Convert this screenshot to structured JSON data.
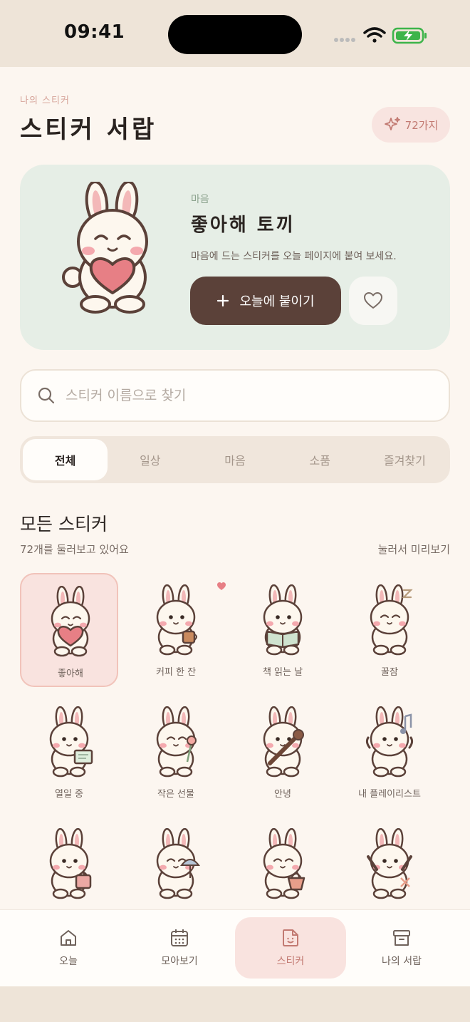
{
  "status_bar": {
    "time": "09:41"
  },
  "header": {
    "subtitle": "나의 스티커",
    "title": "스티커 서랍",
    "count_label": "72가지"
  },
  "featured": {
    "category": "마음",
    "name": "좋아해 토끼",
    "description": "마음에 드는 스티커를 오늘 페이지에 붙여 보세요.",
    "add_button_label": "오늘에 붙이기"
  },
  "search": {
    "placeholder": "스티커 이름으로 찾기",
    "value": ""
  },
  "tabs": [
    {
      "label": "전체",
      "active": true
    },
    {
      "label": "일상",
      "active": false
    },
    {
      "label": "마음",
      "active": false
    },
    {
      "label": "소품",
      "active": false
    },
    {
      "label": "즐겨찾기",
      "active": false
    }
  ],
  "section": {
    "title": "모든 스티커",
    "subtitle": "72개를 둘러보고 있어요",
    "hint": "눌러서 미리보기"
  },
  "stickers": [
    {
      "label": "좋아해",
      "prop": "heart",
      "selected": true,
      "favorite": false
    },
    {
      "label": "커피 한 잔",
      "prop": "coffee",
      "selected": false,
      "favorite": true
    },
    {
      "label": "책 읽는 날",
      "prop": "book",
      "selected": false,
      "favorite": false
    },
    {
      "label": "꿀잠",
      "prop": "sleep",
      "selected": false,
      "favorite": false
    },
    {
      "label": "열일 중",
      "prop": "laptop",
      "selected": false,
      "favorite": false
    },
    {
      "label": "작은 선물",
      "prop": "flower",
      "selected": false,
      "favorite": false
    },
    {
      "label": "안녕",
      "prop": "wave",
      "selected": false,
      "favorite": false
    },
    {
      "label": "내 플레이리스트",
      "prop": "music",
      "selected": false,
      "favorite": false
    },
    {
      "label": "",
      "prop": "bag",
      "selected": false,
      "favorite": false
    },
    {
      "label": "",
      "prop": "rain",
      "selected": false,
      "favorite": false
    },
    {
      "label": "",
      "prop": "basket",
      "selected": false,
      "favorite": false
    },
    {
      "label": "",
      "prop": "cheer",
      "selected": false,
      "favorite": false
    }
  ],
  "tab_bar": [
    {
      "label": "오늘",
      "icon": "home-icon",
      "active": false
    },
    {
      "label": "모아보기",
      "icon": "calendar-icon",
      "active": false
    },
    {
      "label": "스티커",
      "icon": "sticker-icon",
      "active": true
    },
    {
      "label": "나의 서랍",
      "icon": "archive-icon",
      "active": false
    }
  ],
  "colors": {
    "accent": "#c27a72",
    "primary_button": "#5b4139",
    "hero_bg": "#e6eee6",
    "selected_bg": "#f9e3df",
    "background": "#fcf6f0"
  }
}
